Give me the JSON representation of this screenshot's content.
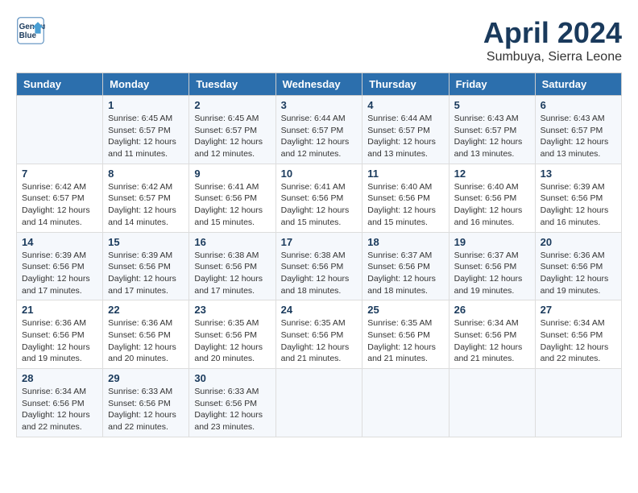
{
  "header": {
    "logo_line1": "General",
    "logo_line2": "Blue",
    "month": "April 2024",
    "location": "Sumbuya, Sierra Leone"
  },
  "days_of_week": [
    "Sunday",
    "Monday",
    "Tuesday",
    "Wednesday",
    "Thursday",
    "Friday",
    "Saturday"
  ],
  "weeks": [
    [
      {
        "num": "",
        "info": ""
      },
      {
        "num": "1",
        "info": "Sunrise: 6:45 AM\nSunset: 6:57 PM\nDaylight: 12 hours\nand 11 minutes."
      },
      {
        "num": "2",
        "info": "Sunrise: 6:45 AM\nSunset: 6:57 PM\nDaylight: 12 hours\nand 12 minutes."
      },
      {
        "num": "3",
        "info": "Sunrise: 6:44 AM\nSunset: 6:57 PM\nDaylight: 12 hours\nand 12 minutes."
      },
      {
        "num": "4",
        "info": "Sunrise: 6:44 AM\nSunset: 6:57 PM\nDaylight: 12 hours\nand 13 minutes."
      },
      {
        "num": "5",
        "info": "Sunrise: 6:43 AM\nSunset: 6:57 PM\nDaylight: 12 hours\nand 13 minutes."
      },
      {
        "num": "6",
        "info": "Sunrise: 6:43 AM\nSunset: 6:57 PM\nDaylight: 12 hours\nand 13 minutes."
      }
    ],
    [
      {
        "num": "7",
        "info": "Sunrise: 6:42 AM\nSunset: 6:57 PM\nDaylight: 12 hours\nand 14 minutes."
      },
      {
        "num": "8",
        "info": "Sunrise: 6:42 AM\nSunset: 6:57 PM\nDaylight: 12 hours\nand 14 minutes."
      },
      {
        "num": "9",
        "info": "Sunrise: 6:41 AM\nSunset: 6:56 PM\nDaylight: 12 hours\nand 15 minutes."
      },
      {
        "num": "10",
        "info": "Sunrise: 6:41 AM\nSunset: 6:56 PM\nDaylight: 12 hours\nand 15 minutes."
      },
      {
        "num": "11",
        "info": "Sunrise: 6:40 AM\nSunset: 6:56 PM\nDaylight: 12 hours\nand 15 minutes."
      },
      {
        "num": "12",
        "info": "Sunrise: 6:40 AM\nSunset: 6:56 PM\nDaylight: 12 hours\nand 16 minutes."
      },
      {
        "num": "13",
        "info": "Sunrise: 6:39 AM\nSunset: 6:56 PM\nDaylight: 12 hours\nand 16 minutes."
      }
    ],
    [
      {
        "num": "14",
        "info": "Sunrise: 6:39 AM\nSunset: 6:56 PM\nDaylight: 12 hours\nand 17 minutes."
      },
      {
        "num": "15",
        "info": "Sunrise: 6:39 AM\nSunset: 6:56 PM\nDaylight: 12 hours\nand 17 minutes."
      },
      {
        "num": "16",
        "info": "Sunrise: 6:38 AM\nSunset: 6:56 PM\nDaylight: 12 hours\nand 17 minutes."
      },
      {
        "num": "17",
        "info": "Sunrise: 6:38 AM\nSunset: 6:56 PM\nDaylight: 12 hours\nand 18 minutes."
      },
      {
        "num": "18",
        "info": "Sunrise: 6:37 AM\nSunset: 6:56 PM\nDaylight: 12 hours\nand 18 minutes."
      },
      {
        "num": "19",
        "info": "Sunrise: 6:37 AM\nSunset: 6:56 PM\nDaylight: 12 hours\nand 19 minutes."
      },
      {
        "num": "20",
        "info": "Sunrise: 6:36 AM\nSunset: 6:56 PM\nDaylight: 12 hours\nand 19 minutes."
      }
    ],
    [
      {
        "num": "21",
        "info": "Sunrise: 6:36 AM\nSunset: 6:56 PM\nDaylight: 12 hours\nand 19 minutes."
      },
      {
        "num": "22",
        "info": "Sunrise: 6:36 AM\nSunset: 6:56 PM\nDaylight: 12 hours\nand 20 minutes."
      },
      {
        "num": "23",
        "info": "Sunrise: 6:35 AM\nSunset: 6:56 PM\nDaylight: 12 hours\nand 20 minutes."
      },
      {
        "num": "24",
        "info": "Sunrise: 6:35 AM\nSunset: 6:56 PM\nDaylight: 12 hours\nand 21 minutes."
      },
      {
        "num": "25",
        "info": "Sunrise: 6:35 AM\nSunset: 6:56 PM\nDaylight: 12 hours\nand 21 minutes."
      },
      {
        "num": "26",
        "info": "Sunrise: 6:34 AM\nSunset: 6:56 PM\nDaylight: 12 hours\nand 21 minutes."
      },
      {
        "num": "27",
        "info": "Sunrise: 6:34 AM\nSunset: 6:56 PM\nDaylight: 12 hours\nand 22 minutes."
      }
    ],
    [
      {
        "num": "28",
        "info": "Sunrise: 6:34 AM\nSunset: 6:56 PM\nDaylight: 12 hours\nand 22 minutes."
      },
      {
        "num": "29",
        "info": "Sunrise: 6:33 AM\nSunset: 6:56 PM\nDaylight: 12 hours\nand 22 minutes."
      },
      {
        "num": "30",
        "info": "Sunrise: 6:33 AM\nSunset: 6:56 PM\nDaylight: 12 hours\nand 23 minutes."
      },
      {
        "num": "",
        "info": ""
      },
      {
        "num": "",
        "info": ""
      },
      {
        "num": "",
        "info": ""
      },
      {
        "num": "",
        "info": ""
      }
    ]
  ]
}
